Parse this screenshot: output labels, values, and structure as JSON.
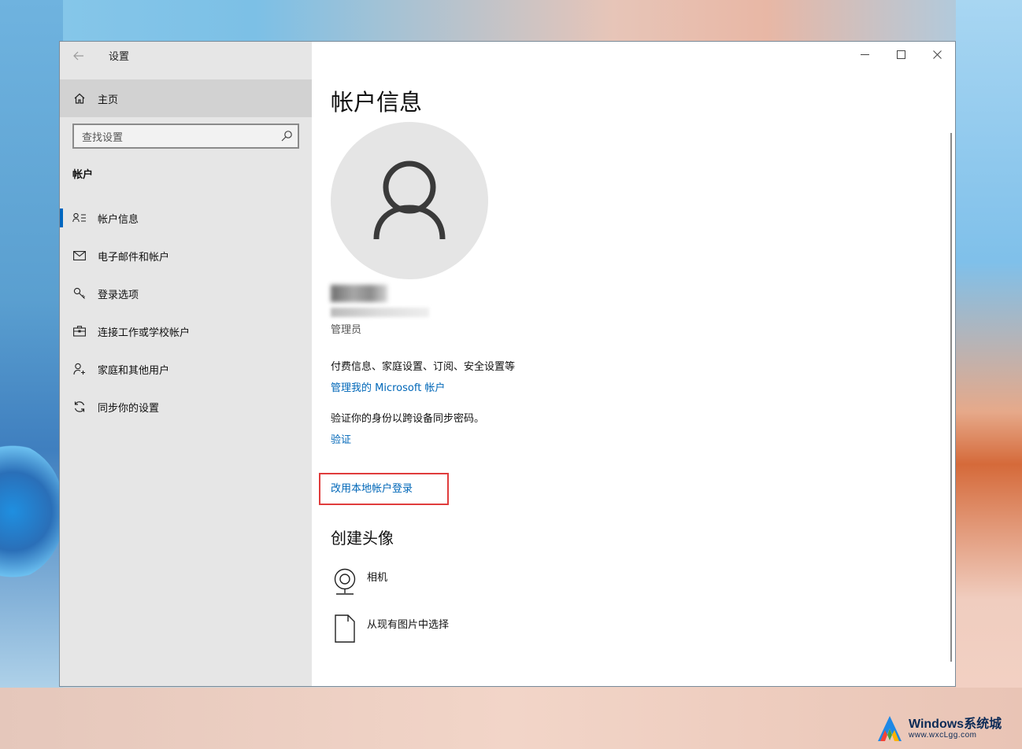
{
  "window": {
    "title": "设置",
    "controls": {
      "minimize": "—",
      "maximize": "☐",
      "close": "✕"
    }
  },
  "sidebar": {
    "home_label": "主页",
    "search_placeholder": "查找设置",
    "section_label": "帐户",
    "items": [
      {
        "label": "帐户信息",
        "icon": "account-info-icon",
        "active": true
      },
      {
        "label": "电子邮件和帐户",
        "icon": "mail-icon",
        "active": false
      },
      {
        "label": "登录选项",
        "icon": "key-icon",
        "active": false
      },
      {
        "label": "连接工作或学校帐户",
        "icon": "briefcase-icon",
        "active": false
      },
      {
        "label": "家庭和其他用户",
        "icon": "add-person-icon",
        "active": false
      },
      {
        "label": "同步你的设置",
        "icon": "sync-icon",
        "active": false
      }
    ]
  },
  "main": {
    "page_title": "帐户信息",
    "user_role": "管理员",
    "billing_text": "付费信息、家庭设置、订阅、安全设置等",
    "manage_link": "管理我的 Microsoft 帐户",
    "verify_text": "验证你的身份以跨设备同步密码。",
    "verify_link": "验证",
    "local_account_link": "改用本地帐户登录",
    "create_avatar_title": "创建头像",
    "camera_label": "相机",
    "browse_label": "从现有图片中选择"
  },
  "watermark": {
    "main": "Windows系统城",
    "sub": "www.wxcLgg.com"
  },
  "colors": {
    "accent": "#0067b8",
    "highlight": "#e03c3c",
    "sidebar_bg": "#e6e6e6"
  }
}
